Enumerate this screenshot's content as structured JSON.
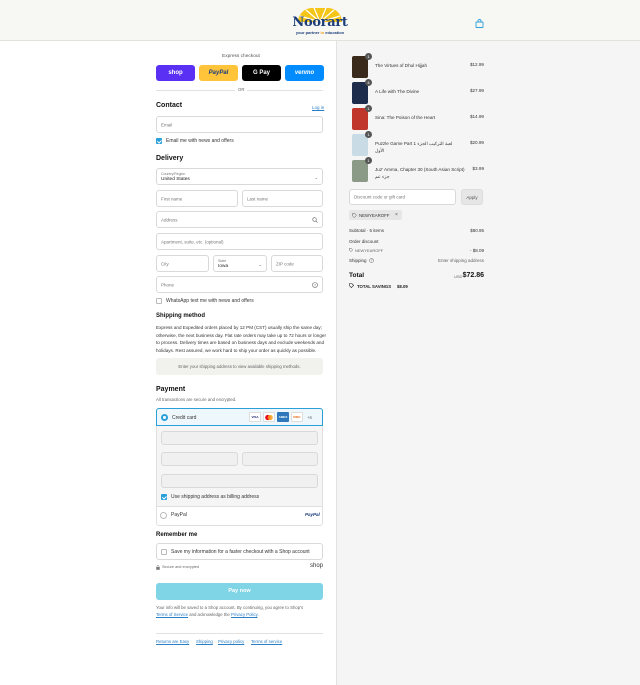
{
  "brand": {
    "name": "Noorart",
    "tagline_pre": "your partner",
    "tagline_mid": " in ",
    "tagline_post": "education"
  },
  "express": {
    "title": "Express checkout",
    "buttons": [
      "shop",
      "PayPal",
      "G Pay",
      "venmo"
    ],
    "or": "OR"
  },
  "contact": {
    "heading": "Contact",
    "login": "Log in",
    "email_placeholder": "Email",
    "news_label": "Email me with news and offers"
  },
  "delivery": {
    "heading": "Delivery",
    "country_label": "Country/Region",
    "country_value": "United States",
    "first_name": "First name",
    "last_name": "Last name",
    "address": "Address",
    "apartment": "Apartment, suite, etc. (optional)",
    "city": "City",
    "state_label": "State",
    "state_value": "Iowa",
    "zip": "ZIP code",
    "phone": "Phone",
    "whatsapp_label": "WhatsApp text me with news and offers"
  },
  "shipping": {
    "heading": "Shipping method",
    "lines": [
      "Express and Expedited orders placed by 12 PM (CST) usually ship the same day;",
      "otherwise, the next business day. Flat rate orders may take up to 72 hours or longer",
      "to process. Delivery times are based on business days and exclude weekends and",
      "holidays. Rest assured, we work hard to ship your order as quickly as possible."
    ],
    "notice": "Enter your shipping address to view available shipping methods."
  },
  "payment": {
    "heading": "Payment",
    "subtitle": "All transactions are secure and encrypted.",
    "credit_label": "Credit card",
    "cards": [
      "VISA",
      "MC",
      "AMEX",
      "DISC",
      "+6"
    ],
    "billing_label": "Use shipping address as billing address",
    "paypal_label": "PayPal",
    "paypal_logo": "PayPal"
  },
  "remember": {
    "heading": "Remember me",
    "save_label": "Save my information for a faster checkout with a Shop account",
    "secure": "Secure and encrypted",
    "shop": "shop"
  },
  "pay_button": "Pay now",
  "legal": {
    "line1": "Your info will be saved to a Shop account. By continuing, you agree to Shop's",
    "tos": "Terms of Service",
    "and": " and acknowledge the ",
    "privacy": "Privacy Policy",
    "end": "."
  },
  "footer_links": [
    "Returns are Easy",
    "Shipping",
    "Privacy policy",
    "Terms of service"
  ],
  "items": [
    {
      "title": "The Virtues of Dhul Hijjah",
      "price": "$12.99",
      "qty": "1",
      "color": "#3a2a1c"
    },
    {
      "title": "A Life with The Divine",
      "price": "$27.99",
      "qty": "4",
      "color": "#1c2c4a"
    },
    {
      "title": "Sina: The Poison of the Heart",
      "price": "$14.99",
      "qty": "1",
      "color": "#c0362c"
    },
    {
      "title": "Puzzle Game Part 1 لعبة التركيب الجزء",
      "title2": "الأول",
      "price": "$20.99",
      "qty": "1",
      "color": "#c9dce6"
    },
    {
      "title": "Juz' Amma, Chapter 30 (South Asian Script)",
      "title2": "جزء عم",
      "price": "$3.99",
      "qty": "1",
      "color": "#8a9a86"
    }
  ],
  "discount": {
    "placeholder": "Discount code or gift card",
    "apply": "Apply",
    "code": "NEWYEAROFF"
  },
  "summary": {
    "subtotal_label": "Subtotal · 5 items",
    "subtotal": "$80.95",
    "order_discount": "Order discount",
    "code": "NEWYEAROFF",
    "discount": "- $8.09",
    "shipping_label": "Shipping",
    "shipping_value": "Enter shipping address",
    "total_label": "Total",
    "currency": "USD",
    "total": "$72.86",
    "savings_label": "TOTAL SAVINGS",
    "savings": "$8.09"
  },
  "colors": {
    "accent": "#2b9fd9",
    "pay_button": "#7fd4e6",
    "shop": "#5a31f4",
    "paypal": "#ffc439",
    "venmo": "#008cff",
    "gpay": "#000000"
  }
}
